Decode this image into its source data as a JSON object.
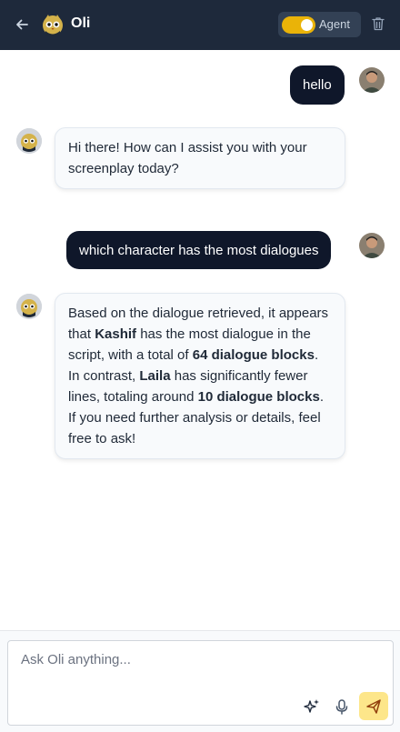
{
  "header": {
    "title": "Oli",
    "agent_label": "Agent",
    "agent_enabled": true,
    "back_icon": "arrow-left-icon",
    "trash_icon": "trash-icon"
  },
  "messages": [
    {
      "role": "user",
      "text": "hello"
    },
    {
      "role": "assistant",
      "text": "Hi there! How can I assist you with your screenplay today?"
    },
    {
      "role": "user",
      "text": "which character has the most dialogues"
    },
    {
      "role": "assistant",
      "parts": [
        {
          "text": "Based on the dialogue retrieved, it appears that ",
          "bold": false
        },
        {
          "text": "Kashif",
          "bold": true
        },
        {
          "text": " has the most dialogue in the script, with a total of ",
          "bold": false
        },
        {
          "text": "64 dialogue blocks",
          "bold": true
        },
        {
          "text": ". In contrast, ",
          "bold": false
        },
        {
          "text": "Laila",
          "bold": true
        },
        {
          "text": " has significantly fewer lines, totaling around ",
          "bold": false
        },
        {
          "text": "10 dialogue blocks",
          "bold": true
        },
        {
          "text": ". If you need further analysis or details, feel free to ask!",
          "bold": false
        }
      ]
    }
  ],
  "input": {
    "placeholder": "Ask Oli anything...",
    "value": ""
  },
  "colors": {
    "header_bg": "#1e293b",
    "user_bubble": "#0f172a",
    "toggle_on": "#eab308",
    "send_button": "#fde68a"
  }
}
